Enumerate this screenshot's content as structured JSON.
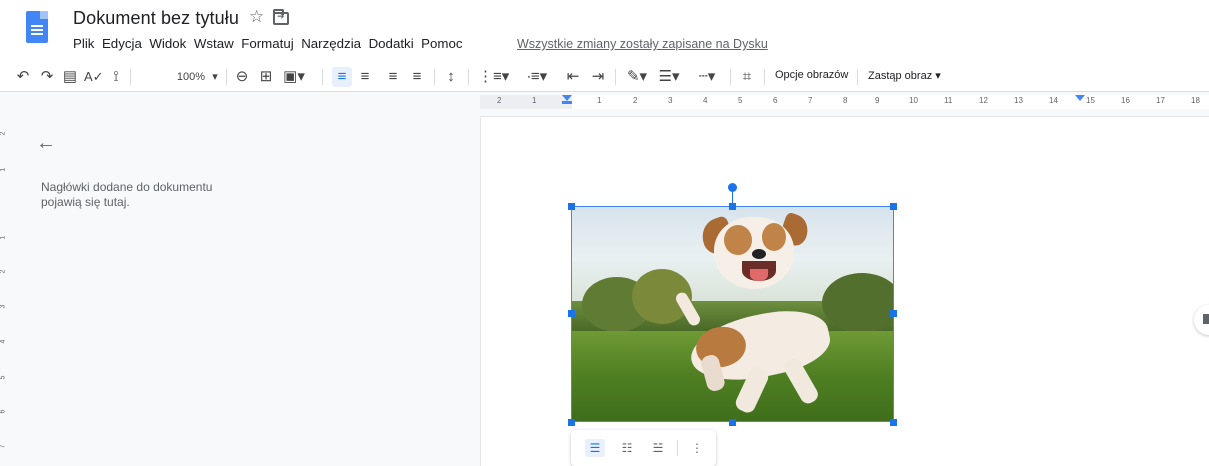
{
  "header": {
    "doc_title": "Dokument bez tytułu",
    "menu": [
      "Plik",
      "Edycja",
      "Widok",
      "Wstaw",
      "Formatuj",
      "Narzędzia",
      "Dodatki",
      "Pomoc"
    ],
    "saved_status": "Wszystkie zmiany zostały zapisane na Dysku"
  },
  "toolbar": {
    "zoom": "100%",
    "image_options_label": "Opcje obrazów",
    "replace_image_label": "Zastąp obraz"
  },
  "ruler": {
    "numbers": [
      "2",
      "1",
      "1",
      "2",
      "3",
      "4",
      "5",
      "6",
      "7",
      "8",
      "9",
      "10",
      "11",
      "12",
      "13",
      "14",
      "15",
      "16",
      "17",
      "18"
    ]
  },
  "vertical_ruler": {
    "numbers": [
      "2",
      "1",
      "1",
      "2",
      "3",
      "4",
      "5",
      "6",
      "7"
    ]
  },
  "outline": {
    "placeholder": "Nagłówki dodane do dokumentu pojawią się tutaj."
  },
  "image": {
    "description_icon": "dog-photo"
  },
  "colors": {
    "accent": "#1a73e8",
    "docs_blue": "#4285f4"
  }
}
